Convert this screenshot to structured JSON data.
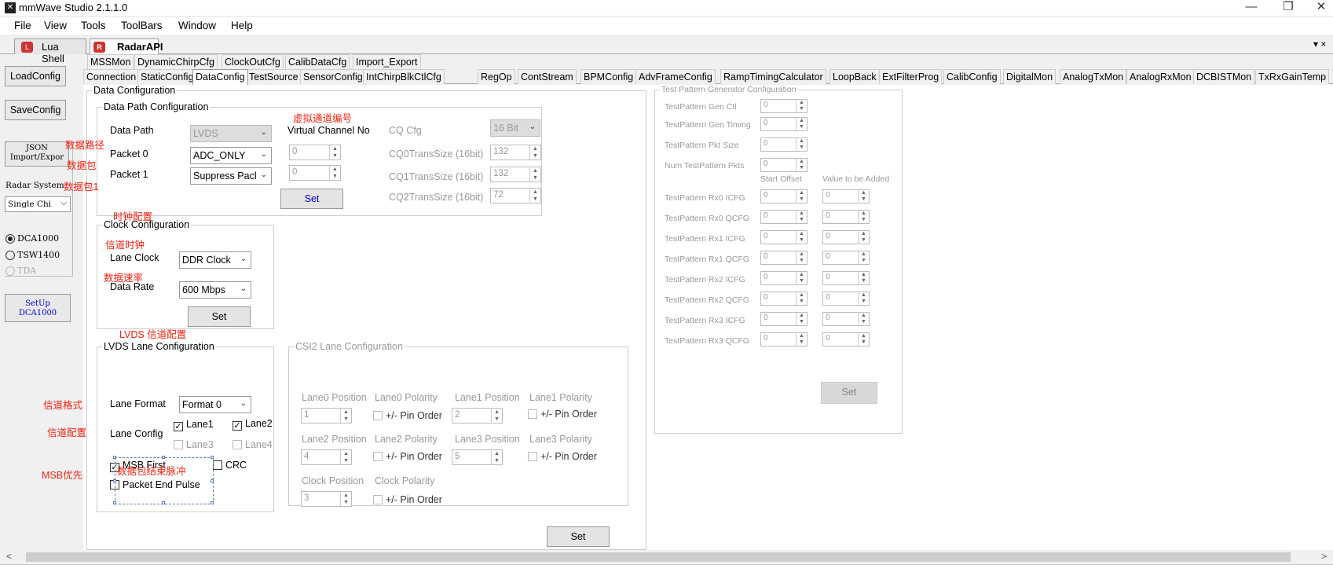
{
  "window": {
    "title": "mmWave Studio 2.1.1.0",
    "minimize": "—",
    "restore": "❐",
    "close": "✕"
  },
  "menu": [
    "File",
    "View",
    "Tools",
    "ToolBars",
    "Window",
    "Help"
  ],
  "doc_tabs": [
    "Lua Shell",
    "RadarAPI"
  ],
  "doc_tab_overflow": "▾ ×",
  "left": {
    "load": "LoadConfig",
    "save": "SaveConfig",
    "json_line1": "JSON",
    "json_line2": "Import/Expor",
    "radar_system_label": "Radar System",
    "radar_system_value": "Single Chi",
    "dca1000": "DCA1000",
    "tsw1400": "TSW1400",
    "tda": "TDA",
    "setup_line1": "SetUp",
    "setup_line2": "DCA1000"
  },
  "tabs_row1": [
    "MSSMon",
    "DynamicChirpCfg",
    "ClockOutCfg",
    "CalibDataCfg",
    "Import_Export"
  ],
  "tabs_row2": [
    "Connection",
    "StaticConfig",
    "DataConfig",
    "TestSource",
    "SensorConfig",
    "IntChirpBlkCtlCfg",
    "RegOp",
    "ContStream",
    "BPMConfig",
    "AdvFrameConfig",
    "RampTimingCalculator",
    "LoopBack",
    "ExtFilterProg",
    "CalibConfig",
    "DigitalMon",
    "AnalogTxMon",
    "AnalogRxMon",
    "DCBISTMon",
    "TxRxGainTemp"
  ],
  "data_config": {
    "title": "Data Configuration",
    "path": {
      "title": "Data Path Configuration",
      "data_path_label": "Data Path",
      "data_path_value": "LVDS",
      "vc_label": "Virtual Channel No",
      "cq_cfg_label": "CQ Cfg",
      "cq_cfg_value": "16 Bit",
      "packet0_label": "Packet 0",
      "packet0_value": "ADC_ONLY",
      "packet0_vc": "0",
      "packet1_label": "Packet 1",
      "packet1_value": "Suppress Pacl",
      "packet1_vc": "0",
      "cq0_label": "CQ0TransSize (16bit)",
      "cq0_value": "132",
      "cq1_label": "CQ1TransSize (16bit)",
      "cq1_value": "132",
      "cq2_label": "CQ2TransSize (16bit)",
      "cq2_value": "72",
      "set": "Set"
    },
    "clock": {
      "title": "Clock Configuration",
      "lane_clock_label": "Lane Clock",
      "lane_clock_value": "DDR Clock",
      "data_rate_label": "Data Rate",
      "data_rate_value": "600 Mbps",
      "set": "Set"
    },
    "lvds": {
      "title": "LVDS Lane Configuration",
      "lane_format_label": "Lane Format",
      "lane_format_value": "Format 0",
      "lane_config_label": "Lane Config",
      "lane1": "Lane1",
      "lane2": "Lane2",
      "lane3": "Lane3",
      "lane4": "Lane4",
      "msb_first": "MSB First",
      "crc": "CRC",
      "packet_end_pulse": "Packet End Pulse",
      "check": "✓"
    },
    "csi2": {
      "title": "CSI2 Lane Configuration",
      "lane0_pos": "Lane0 Position",
      "lane0_pol": "Lane0 Polarity",
      "lane1_pos": "Lane1 Position",
      "lane1_pol": "Lane1 Polarity",
      "lane2_pos": "Lane2 Position",
      "lane2_pol": "Lane2 Polarity",
      "lane3_pos": "Lane3 Position",
      "lane3_pol": "Lane3 Polarity",
      "clock_pos": "Clock Position",
      "clock_pol": "Clock Polarity",
      "pin_order": "+/- Pin Order",
      "v0": "1",
      "v1": "2",
      "v2": "4",
      "v3": "5",
      "vc": "3",
      "set": "Set"
    }
  },
  "test_pattern": {
    "title": "Test Pattern Generator Configuration",
    "gen_ctl": "TestPattern Gen Ctl",
    "gen_timing": "TestPattern Gen Timing",
    "pkt_size": "TestPattern Pkt Size",
    "num_pkts": "Num TestPattern Pkts",
    "start_offset": "Start Offset",
    "value_added": "Value to be Added",
    "rows": [
      "TestPattern Rx0 ICFG",
      "TestPattern Rx0 QCFG",
      "TestPattern Rx1 ICFG",
      "TestPattern Rx1 QCFG",
      "TestPattern Rx2 ICFG",
      "TestPattern Rx2 QCFG",
      "TestPattern Rx3 ICFG",
      "TestPattern Rx3 QCFG"
    ],
    "zero": "0",
    "set": "Set"
  },
  "annotations": {
    "vc_no": "虚拟通道编号",
    "data_path": "数据路径",
    "packet": "数据包",
    "packet1": "数据包1",
    "clock_cfg": "时钟配置",
    "channel_clock": "信道时钟",
    "data_rate": "数据速率",
    "lvds_cfg": "LVDS 信道配置",
    "channel_format": "信道格式",
    "channel_cfg": "信道配置",
    "msb_first": "MSB优先",
    "packet_end": "数据包结束脉冲"
  },
  "scroll": {
    "left": "<",
    "right": ">"
  },
  "colors": {
    "annotation": "#e21111",
    "link_blue": "#0000cc"
  }
}
